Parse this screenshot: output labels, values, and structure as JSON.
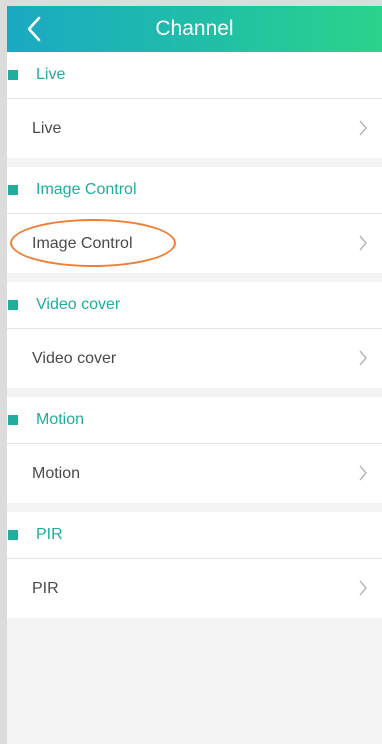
{
  "header": {
    "title": "Channel",
    "back_icon": "chevron-left-icon"
  },
  "sections": [
    {
      "title": "Live",
      "item": "Live"
    },
    {
      "title": "Image Control",
      "item": "Image Control"
    },
    {
      "title": "Video cover",
      "item": "Video cover"
    },
    {
      "title": "Motion",
      "item": "Motion"
    },
    {
      "title": "PIR",
      "item": "PIR"
    }
  ],
  "annotation": {
    "highlighted_item": "Image Control",
    "color": "#f07d32"
  },
  "colors": {
    "accent": "#1fae9b",
    "header_start": "#1aa9c4",
    "header_end": "#2cd38a"
  }
}
